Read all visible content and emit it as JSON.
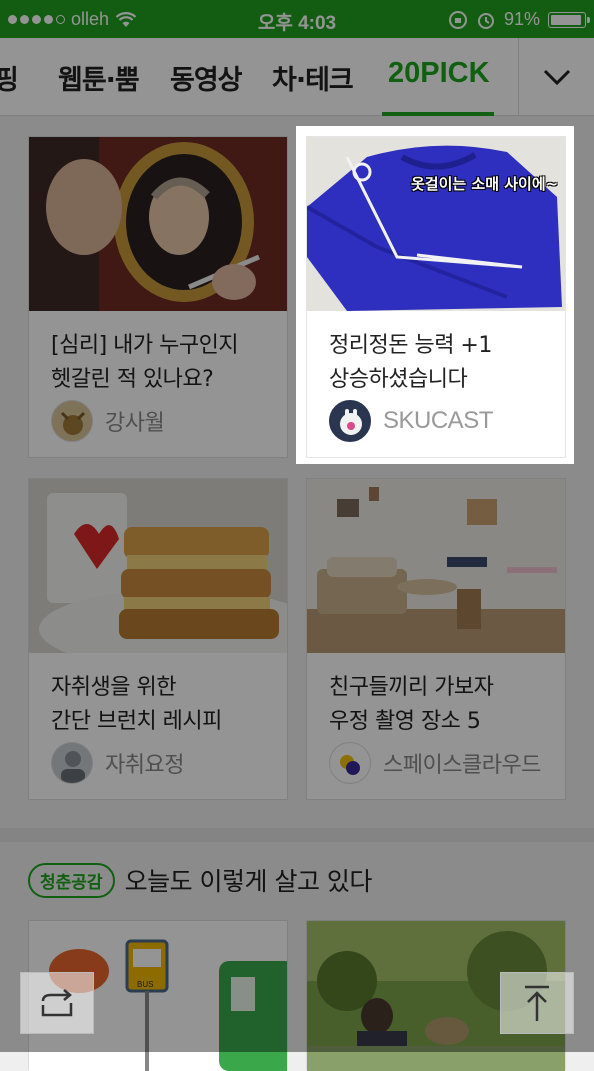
{
  "status_bar": {
    "carrier": "olleh",
    "time": "오후 4:03",
    "battery": "91%",
    "battery_level": 0.91
  },
  "tabs": {
    "items": [
      {
        "label": "핑"
      },
      {
        "label": "웹툰·뿜"
      },
      {
        "label": "동영상"
      },
      {
        "label": "차·테크"
      },
      {
        "label": "20PICK"
      }
    ],
    "active_index": 4,
    "more_icon": "chevron-down-icon",
    "accent_color": "#1ea51e"
  },
  "cards": [
    {
      "title_line1": "[심리] 내가 누구인지",
      "title_line2": "헷갈린 적 있나요?",
      "author": "강사월"
    },
    {
      "title_line1": "정리정돈 능력 +1",
      "title_line2": "상승하셨습니다",
      "author": "SKUCAST",
      "image_caption": "옷걸이는 소매 사이에~"
    },
    {
      "title_line1": "자취생을 위한",
      "title_line2": "간단 브런치 레시피",
      "author": "자취요정"
    },
    {
      "title_line1": "친구들끼리 가보자",
      "title_line2": "우정 촬영 장소 5",
      "author": "스페이스클라우드"
    }
  ],
  "section": {
    "badge": "청춘공감",
    "title": "오늘도 이렇게 살고 있다",
    "bus_sign": "BUS"
  },
  "floating": {
    "share_icon": "share-icon",
    "top_icon": "scroll-top-icon"
  }
}
